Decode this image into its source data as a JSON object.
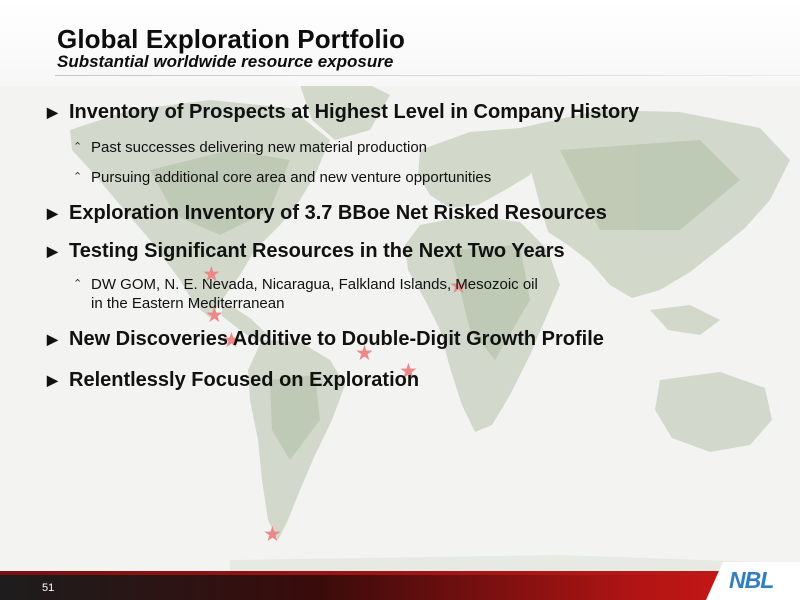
{
  "slide": {
    "title": "Global Exploration Portfolio",
    "subtitle": "Substantial worldwide resource exposure",
    "bullets": [
      {
        "text": "Inventory of Prospects at Highest Level in Company History",
        "sub": [
          "Past successes delivering new material production",
          "Pursuing additional core area and new venture opportunities"
        ]
      },
      {
        "text": "Exploration Inventory of 3.7 BBoe Net Risked Resources"
      },
      {
        "text": "Testing Significant Resources in the Next Two Years",
        "sub": [
          "DW GOM, N. E. Nevada, Nicaragua, Falkland Islands, Mesozoic oil",
          "in the Eastern Mediterranean"
        ]
      },
      {
        "text": "New Discoveries Additive to Double-Digit Growth Profile"
      },
      {
        "text": "Relentlessly Focused on Exploration"
      }
    ],
    "icons": {
      "bullet_arrow": "triangle-right-icon",
      "sub_bullet": "chevron-up-icon",
      "map_marker": "star-icon"
    }
  },
  "footer": {
    "page_number": "51",
    "logo_text": "NBL"
  },
  "colors": {
    "marker": "#ec8888",
    "footer_red": "#c41a1a",
    "logo_blue": "#2f7fc1"
  }
}
